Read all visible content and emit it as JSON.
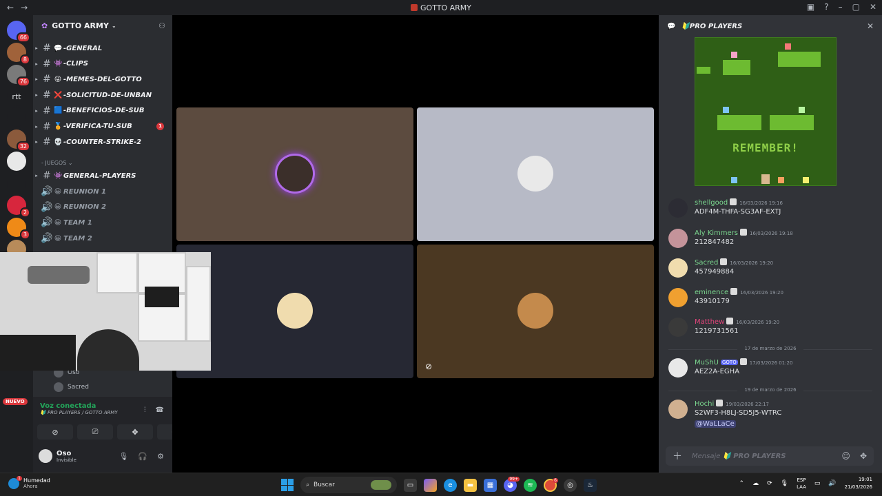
{
  "window": {
    "title": "GOTTO ARMY"
  },
  "rail": {
    "servers": [
      {
        "label": "",
        "badge": "66",
        "color": "#5865f2"
      },
      {
        "label": "",
        "badge": "8",
        "color": "#a0623a"
      },
      {
        "label": "",
        "badge": "76",
        "color": "#7a7a7a"
      },
      {
        "label": "rtt",
        "badge": "",
        "color": "#1e1f22"
      },
      {
        "label": "",
        "badge": "",
        "color": "#1e1f22"
      },
      {
        "label": "",
        "badge": "32",
        "color": "#8b5a3c"
      },
      {
        "label": "",
        "badge": "",
        "color": "#e8e8e8"
      },
      {
        "label": "",
        "badge": "",
        "color": "#1e1f22"
      },
      {
        "label": "",
        "badge": "2",
        "color": "#d7263d"
      },
      {
        "label": "",
        "badge": "3",
        "color": "#ef8a17"
      },
      {
        "label": "",
        "badge": "",
        "color": "#b88b5a"
      }
    ],
    "new_label": "NUEVO"
  },
  "sidebar": {
    "server_name": "GOTTO ARMY",
    "channels": [
      {
        "emoji": "💬",
        "name": "-GENERAL",
        "unread": ""
      },
      {
        "emoji": "👾",
        "name": "-CLIPS",
        "unread": ""
      },
      {
        "emoji": "😜",
        "name": "-MEMES-DEL-GOTTO",
        "unread": ""
      },
      {
        "emoji": "❌",
        "name": "-SOLICITUD-DE-UNBAN",
        "unread": ""
      },
      {
        "emoji": "🟦",
        "name": "-BENEFICIOS-DE-SUB",
        "unread": ""
      },
      {
        "emoji": "🏅",
        "name": "-VERIFICA-TU-SUB",
        "unread": "1"
      },
      {
        "emoji": "💀",
        "name": "-COUNTER-STRIKE-2",
        "unread": ""
      }
    ],
    "category": "- JUEGOS",
    "game_channels": [
      {
        "emoji": "👾",
        "name": "GENERAL-PLAYERS"
      }
    ],
    "voice_channels": [
      {
        "emoji": "😀",
        "name": "REUNION 1"
      },
      {
        "emoji": "😀",
        "name": "REUNION 2"
      },
      {
        "emoji": "😀",
        "name": "TEAM 1"
      },
      {
        "emoji": "😀",
        "name": "TEAM 2"
      }
    ],
    "voice_users": [
      "Oso",
      "Sacred"
    ]
  },
  "voice_panel": {
    "status": "Voz conectada",
    "channel": "PRO PLAYERS / GOTTO ARMY",
    "user_name": "Oso",
    "user_status": "Invisible"
  },
  "stage": {
    "tiles": [
      {
        "bg": "#5c4b3f",
        "avatar_color": "#3b2f2a",
        "speaking": true
      },
      {
        "bg": "#b7bac6",
        "avatar_color": "#e9e9e9",
        "speaking": false
      },
      {
        "bg": "#262833",
        "avatar_color": "#f0dcae",
        "speaking": false
      },
      {
        "bg": "#4b3822",
        "avatar_color": "#c48a4c",
        "speaking": false
      }
    ]
  },
  "chat": {
    "channel": "PRO PLAYERS",
    "image_text": "REMEMBER!",
    "messages": [
      {
        "author": "shellgood",
        "color": "#7bd88f",
        "tag": "",
        "time": "16/03/2026 19:16",
        "text": "ADF4M-THFA-SG3AF-EXTJ",
        "avatar": "#2c2c34"
      },
      {
        "author": "Aly Kimmers",
        "color": "#7bd88f",
        "tag": "",
        "time": "16/03/2026 19:18",
        "text": "212847482",
        "avatar": "#c4939a"
      },
      {
        "author": "Sacred",
        "color": "#7bd88f",
        "tag": "",
        "time": "16/03/2026 19:20",
        "text": "457949884",
        "avatar": "#f0dcae"
      },
      {
        "author": "eminence",
        "color": "#7bd88f",
        "tag": "",
        "time": "16/03/2026 19:20",
        "text": "43910179",
        "avatar": "#f0a030"
      },
      {
        "author": "Matthew",
        "color": "#e0447a",
        "tag": "",
        "time": "16/03/2026 19:20",
        "text": "1219731561",
        "avatar": "#3a3a3a"
      },
      {
        "author": "MuShU",
        "color": "#7bd88f",
        "tag": "GOTO",
        "time": "17/03/2026 01:20",
        "text": "AEZ2A-EGHA",
        "avatar": "#e8e8e8"
      },
      {
        "author": "Hochi",
        "color": "#7bd88f",
        "tag": "",
        "time": "19/03/2026 22:17",
        "text": "S2WF3-H8LJ-SD5J5-WTRC",
        "avatar": "#d0b090"
      }
    ],
    "dividers": [
      "17 de marzo de 2026",
      "19 de marzo de 2026"
    ],
    "mention": "@WaLLaCe",
    "composer_label": "Mensaje",
    "composer_channel": "PRO PLAYERS"
  },
  "taskbar": {
    "weather_title": "Humedad",
    "weather_sub": "Ahora",
    "weather_badge": "1",
    "search_placeholder": "Buscar",
    "lang_top": "ESP",
    "lang_bottom": "LAA",
    "time": "19:01",
    "date": "21/03/2026"
  }
}
